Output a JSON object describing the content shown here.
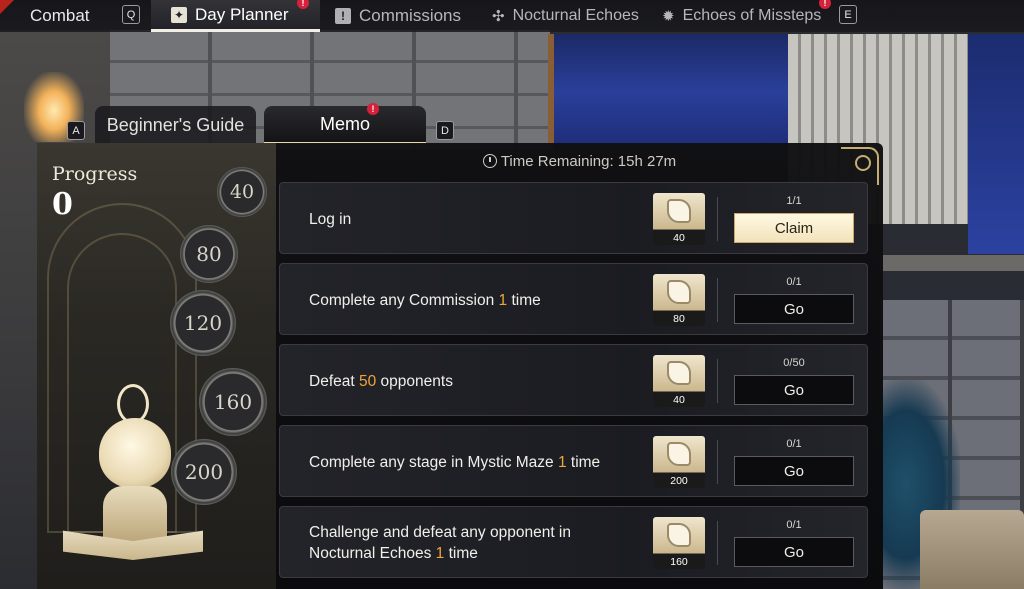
{
  "nav": {
    "combat": "Combat",
    "combat_key": "Q",
    "day_planner": "Day Planner",
    "commissions": "Commissions",
    "nocturnal_echoes": "Nocturnal Echoes",
    "echoes_of_missteps": "Echoes of Missteps",
    "next_key": "E",
    "badge": "!"
  },
  "tabs": {
    "prev_key": "A",
    "beginners_guide": "Beginner's Guide",
    "memo": "Memo",
    "next_key": "D",
    "badge": "!"
  },
  "progress": {
    "label": "Progress",
    "value": "0",
    "milestones": [
      "40",
      "80",
      "120",
      "160",
      "200"
    ]
  },
  "time_remaining": "Time Remaining: 15h 27m",
  "tasks": [
    {
      "pre": "Log in",
      "num": "",
      "post": "",
      "reward": "40",
      "count": "1/1",
      "action": "Claim"
    },
    {
      "pre": "Complete any Commission ",
      "num": "1",
      "post": " time",
      "reward": "80",
      "count": "0/1",
      "action": "Go"
    },
    {
      "pre": "Defeat ",
      "num": "50",
      "post": " opponents",
      "reward": "40",
      "count": "0/50",
      "action": "Go"
    },
    {
      "pre": "Complete any stage in Mystic Maze ",
      "num": "1",
      "post": " time",
      "reward": "200",
      "count": "0/1",
      "action": "Go"
    },
    {
      "pre": "Challenge and defeat any opponent in Nocturnal Echoes ",
      "num": "1",
      "post": " time",
      "reward": "160",
      "count": "0/1",
      "action": "Go"
    }
  ]
}
